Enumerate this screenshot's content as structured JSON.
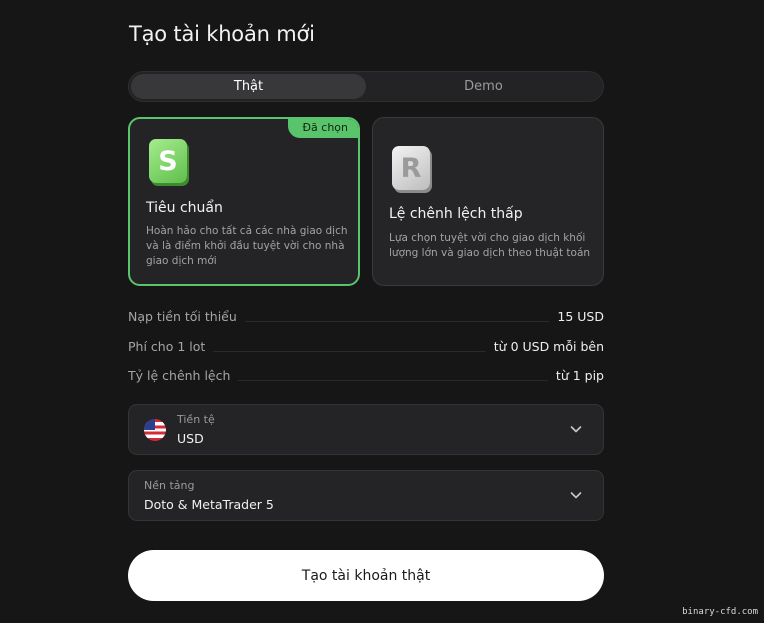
{
  "page": {
    "title": "Tạo tài khoản mới"
  },
  "tabs": [
    {
      "label": "Thật",
      "active": true
    },
    {
      "label": "Demo",
      "active": false
    }
  ],
  "account_types": [
    {
      "logo_letter": "S",
      "name": "Tiêu chuẩn",
      "description": "Hoàn hảo cho tất cả các nhà giao dịch và là điểm khởi đầu tuyệt vời cho nhà giao dịch mới",
      "selected": true,
      "badge": "Đã chọn",
      "accent": "#5ac46c"
    },
    {
      "logo_letter": "R",
      "name": "Lệ chênh lệch thấp",
      "description": "Lựa chọn tuyệt vời cho giao dịch khối lượng lớn và giao dịch theo thuật toán",
      "selected": false
    }
  ],
  "specs": [
    {
      "label": "Nạp tiền tối thiểu",
      "value": "15 USD"
    },
    {
      "label": "Phí cho 1 lot",
      "value": "từ 0 USD mỗi bên"
    },
    {
      "label": "Tỷ lệ chênh lệch",
      "value": "từ 1 pip"
    }
  ],
  "currency": {
    "label": "Tiền tệ",
    "value": "USD",
    "icon": "us-flag-icon"
  },
  "platform": {
    "label": "Nền tảng",
    "value": "Doto & MetaTrader 5"
  },
  "cta": {
    "label": "Tạo tài khoản thật"
  },
  "watermark": "binary-cfd.com"
}
